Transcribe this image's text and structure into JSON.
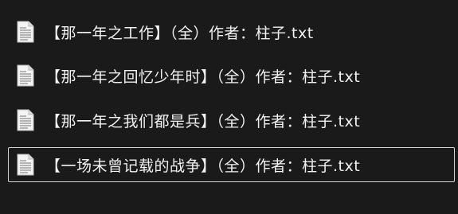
{
  "files": [
    {
      "name": "【那一年之工作】（全）作者：柱子.txt",
      "icon": "text-file-icon",
      "selected": false
    },
    {
      "name": "【那一年之回忆少年时】（全）作者：柱子.txt",
      "icon": "text-file-icon",
      "selected": false
    },
    {
      "name": "【那一年之我们都是兵】（全）作者：柱子.txt",
      "icon": "text-file-icon",
      "selected": false
    },
    {
      "name": "【一场未曾记载的战争】（全）作者：柱子.txt",
      "icon": "text-file-icon",
      "selected": true
    }
  ],
  "colors": {
    "background": "#1a1a1a",
    "text": "#f2f2f2",
    "selection_border": "#d4d4d4"
  }
}
